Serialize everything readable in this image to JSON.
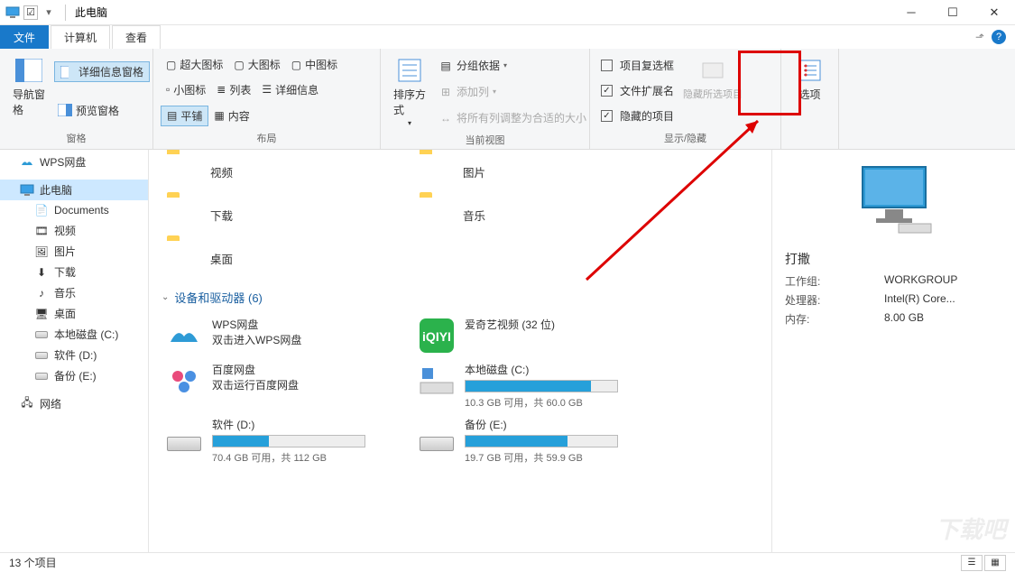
{
  "title": "此电脑",
  "tabs": {
    "file": "文件",
    "computer": "计算机",
    "view": "查看"
  },
  "ribbon": {
    "panes": {
      "nav": "导航窗格",
      "preview": "预览窗格",
      "details_pane": "详细信息窗格",
      "group_panes": "窗格"
    },
    "layout": {
      "xl": "超大图标",
      "l": "大图标",
      "m": "中图标",
      "s": "小图标",
      "list": "列表",
      "details": "详细信息",
      "tiles": "平铺",
      "content": "内容",
      "group": "布局"
    },
    "view": {
      "sort": "排序方式",
      "group_by": "分组依据",
      "add_col": "添加列",
      "autosize": "将所有列调整为合适的大小",
      "group": "当前视图"
    },
    "showhide": {
      "item_chk": "项目复选框",
      "ext": "文件扩展名",
      "hidden": "隐藏的项目",
      "hide_sel": "隐藏所选项目",
      "group": "显示/隐藏"
    },
    "options": "选项"
  },
  "sidebar": {
    "wps": "WPS网盘",
    "thispc": "此电脑",
    "docs": "Documents",
    "videos": "视频",
    "pictures": "图片",
    "downloads": "下载",
    "music": "音乐",
    "desktop": "桌面",
    "cdrive": "本地磁盘 (C:)",
    "ddrive": "软件 (D:)",
    "edrive": "备份 (E:)",
    "network": "网络"
  },
  "folders": {
    "videos": "视频",
    "pictures": "图片",
    "downloads": "下载",
    "music": "音乐",
    "desktop": "桌面"
  },
  "section_devices": "设备和驱动器 (6)",
  "wps": {
    "name": "WPS网盘",
    "sub": "双击进入WPS网盘"
  },
  "iqiyi": {
    "name": "爱奇艺视频 (32 位)"
  },
  "baidu": {
    "name": "百度网盘",
    "sub": "双击运行百度网盘"
  },
  "drives": {
    "c": {
      "name": "本地磁盘 (C:)",
      "free": "10.3 GB 可用，共 60.0 GB",
      "pct": 83
    },
    "d": {
      "name": "软件 (D:)",
      "free": "70.4 GB 可用，共 112 GB",
      "pct": 37
    },
    "e": {
      "name": "备份 (E:)",
      "free": "19.7 GB 可用，共 59.9 GB",
      "pct": 67
    }
  },
  "details": {
    "title": "打撒",
    "workgroup_k": "工作组:",
    "workgroup_v": "WORKGROUP",
    "cpu_k": "处理器:",
    "cpu_v": "Intel(R) Core...",
    "mem_k": "内存:",
    "mem_v": "8.00 GB"
  },
  "status": "13 个项目"
}
